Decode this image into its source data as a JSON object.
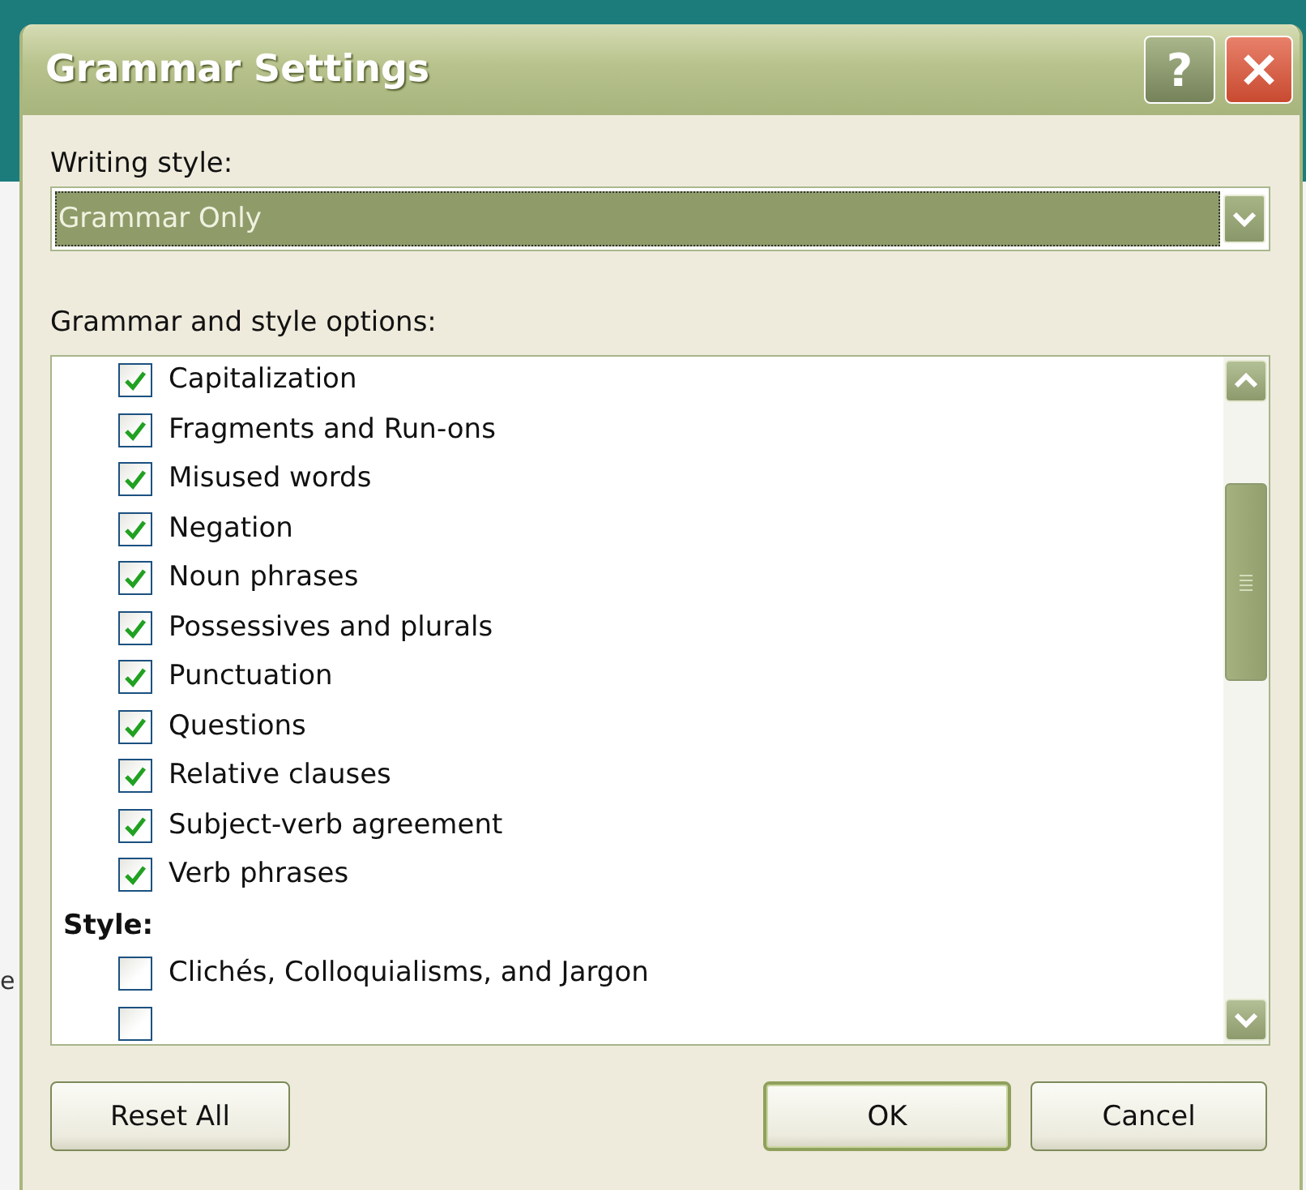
{
  "background": {
    "fragment": "e"
  },
  "window": {
    "title": "Grammar Settings",
    "help_button": "?"
  },
  "writing_style": {
    "label": "Writing style:",
    "value": "Grammar Only"
  },
  "options": {
    "label": "Grammar and style options:",
    "items": [
      {
        "kind": "check",
        "label": "Capitalization",
        "checked": true
      },
      {
        "kind": "check",
        "label": "Fragments and Run-ons",
        "checked": true
      },
      {
        "kind": "check",
        "label": "Misused words",
        "checked": true
      },
      {
        "kind": "check",
        "label": "Negation",
        "checked": true
      },
      {
        "kind": "check",
        "label": "Noun phrases",
        "checked": true
      },
      {
        "kind": "check",
        "label": "Possessives and plurals",
        "checked": true
      },
      {
        "kind": "check",
        "label": "Punctuation",
        "checked": true
      },
      {
        "kind": "check",
        "label": "Questions",
        "checked": true
      },
      {
        "kind": "check",
        "label": "Relative clauses",
        "checked": true
      },
      {
        "kind": "check",
        "label": "Subject-verb agreement",
        "checked": true
      },
      {
        "kind": "check",
        "label": "Verb phrases",
        "checked": true
      },
      {
        "kind": "heading",
        "label": "Style:"
      },
      {
        "kind": "check",
        "label": "Clichés, Colloquialisms, and Jargon",
        "checked": false
      },
      {
        "kind": "check",
        "checked": false
      }
    ]
  },
  "buttons": [
    {
      "label": "Reset All",
      "default": false
    },
    {
      "label": "OK",
      "default": true
    },
    {
      "label": "Cancel",
      "default": false
    }
  ]
}
